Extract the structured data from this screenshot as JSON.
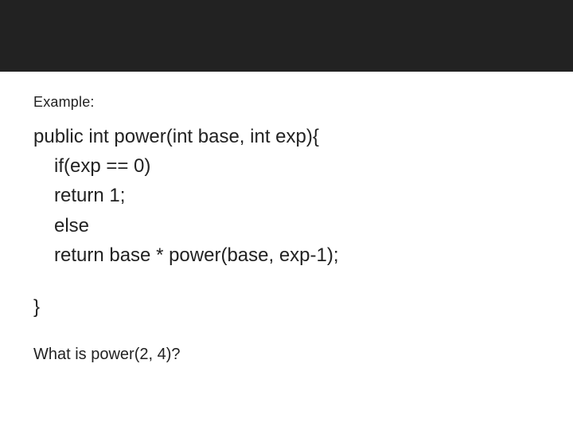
{
  "label": "Example:",
  "code": {
    "l1": "public int power(int base, int exp){",
    "l2": "if(exp == 0)",
    "l3": "return 1;",
    "l4": "else",
    "l5": "return base * power(base, exp-1);",
    "l6": "}"
  },
  "question": "What  is power(2, 4)?"
}
